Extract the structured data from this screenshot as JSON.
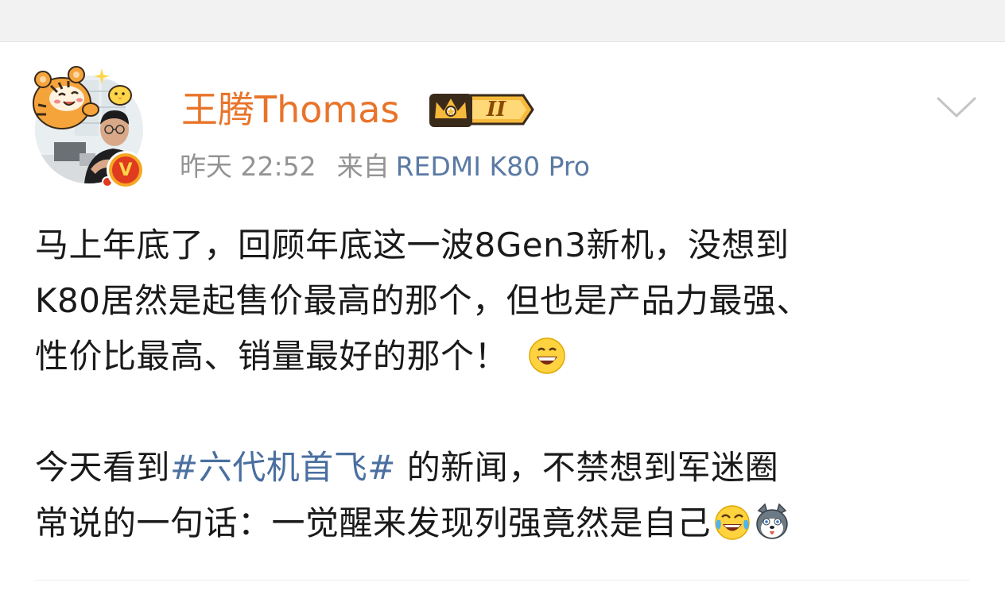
{
  "post": {
    "author": {
      "name": "王腾Thomas",
      "level": "II",
      "verified_mark": "V",
      "name_color": "#e8742a"
    },
    "meta": {
      "time": "昨天 22:52",
      "source_label": "来自",
      "device": "REDMI K80 Pro",
      "device_color": "#5b7aa3"
    },
    "paragraph1": {
      "line1": "马上年底了，回顾年底这一波8Gen3新机，没想到",
      "line2": "K80居然是起售价最高的那个，但也是产品力最强、",
      "line3": "性价比最高、销量最好的那个！"
    },
    "paragraph2": {
      "line1_prefix": "今天看到",
      "hashtag": "#六代机首飞#",
      "line1_suffix": " 的新闻，不禁想到军迷圈",
      "line2": "常说的一句话：一觉醒来发现列强竟然是自己"
    },
    "icons": {
      "grin": "grinning-face-icon",
      "laugh_cry": "tears-of-joy-icon",
      "husky": "husky-dog-icon",
      "dropdown": "chevron-down-icon",
      "crown": "crown-icon"
    },
    "colors": {
      "hashtag": "#4a6fa0",
      "text": "#1a1a1a",
      "meta": "#939393"
    }
  }
}
